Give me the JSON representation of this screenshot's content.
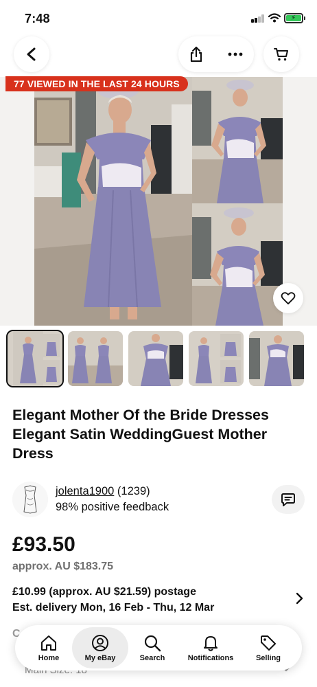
{
  "status_bar": {
    "time": "7:48"
  },
  "listing": {
    "viewed_banner": "77 VIEWED IN THE LAST 24 HOURS",
    "title": "Elegant Mother Of the Bride Dresses Elegant Satin WeddingGuest Mother Dress",
    "thumbnail_count": 5,
    "selected_thumbnail": 1
  },
  "seller": {
    "name": "jolenta1900",
    "rating_count": "(1239)",
    "feedback": "98% positive feedback"
  },
  "pricing": {
    "price": "£93.50",
    "approx": "approx. AU $183.75",
    "postage": "£10.99 (approx. AU $21.59) postage",
    "delivery": "Est. delivery Mon, 16 Feb - Thu, 12 Mar"
  },
  "obscured": {
    "partial_text": "C",
    "size_text": "Main Size:  18"
  },
  "tabbar": {
    "tabs": [
      {
        "label": "Home",
        "icon": "home-icon"
      },
      {
        "label": "My eBay",
        "icon": "user-icon"
      },
      {
        "label": "Search",
        "icon": "search-icon"
      },
      {
        "label": "Notifications",
        "icon": "bell-icon"
      },
      {
        "label": "Selling",
        "icon": "tag-icon"
      }
    ],
    "active_index": 1
  },
  "colors": {
    "banner": "#d8311c",
    "dress": "#8b86b8",
    "text": "#111111",
    "muted": "#707070"
  }
}
